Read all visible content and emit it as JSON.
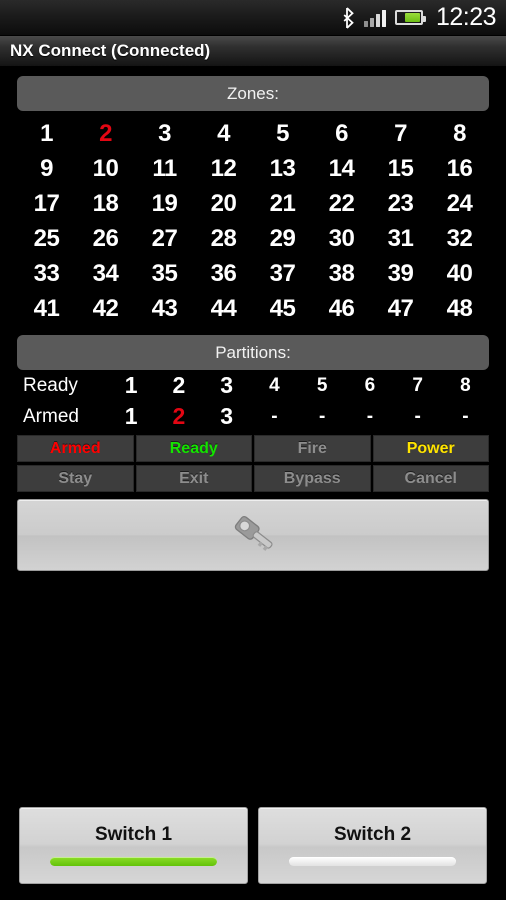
{
  "status_bar": {
    "bluetooth_icon": "bluetooth-icon",
    "signal_icon": "signal-bars-icon",
    "battery_icon": "battery-icon",
    "clock": "12:23"
  },
  "title_bar": {
    "title": "NX Connect (Connected)"
  },
  "zones": {
    "header": "Zones:",
    "items": [
      {
        "label": "1",
        "state": "normal"
      },
      {
        "label": "2",
        "state": "alert"
      },
      {
        "label": "3",
        "state": "normal"
      },
      {
        "label": "4",
        "state": "normal"
      },
      {
        "label": "5",
        "state": "normal"
      },
      {
        "label": "6",
        "state": "normal"
      },
      {
        "label": "7",
        "state": "normal"
      },
      {
        "label": "8",
        "state": "normal"
      },
      {
        "label": "9",
        "state": "normal"
      },
      {
        "label": "10",
        "state": "normal"
      },
      {
        "label": "11",
        "state": "normal"
      },
      {
        "label": "12",
        "state": "normal"
      },
      {
        "label": "13",
        "state": "normal"
      },
      {
        "label": "14",
        "state": "normal"
      },
      {
        "label": "15",
        "state": "normal"
      },
      {
        "label": "16",
        "state": "normal"
      },
      {
        "label": "17",
        "state": "normal"
      },
      {
        "label": "18",
        "state": "normal"
      },
      {
        "label": "19",
        "state": "normal"
      },
      {
        "label": "20",
        "state": "normal"
      },
      {
        "label": "21",
        "state": "normal"
      },
      {
        "label": "22",
        "state": "normal"
      },
      {
        "label": "23",
        "state": "normal"
      },
      {
        "label": "24",
        "state": "normal"
      },
      {
        "label": "25",
        "state": "normal"
      },
      {
        "label": "26",
        "state": "normal"
      },
      {
        "label": "27",
        "state": "normal"
      },
      {
        "label": "28",
        "state": "normal"
      },
      {
        "label": "29",
        "state": "normal"
      },
      {
        "label": "30",
        "state": "normal"
      },
      {
        "label": "31",
        "state": "normal"
      },
      {
        "label": "32",
        "state": "normal"
      },
      {
        "label": "33",
        "state": "normal"
      },
      {
        "label": "34",
        "state": "normal"
      },
      {
        "label": "35",
        "state": "normal"
      },
      {
        "label": "36",
        "state": "normal"
      },
      {
        "label": "37",
        "state": "normal"
      },
      {
        "label": "38",
        "state": "normal"
      },
      {
        "label": "39",
        "state": "normal"
      },
      {
        "label": "40",
        "state": "normal"
      },
      {
        "label": "41",
        "state": "normal"
      },
      {
        "label": "42",
        "state": "normal"
      },
      {
        "label": "43",
        "state": "normal"
      },
      {
        "label": "44",
        "state": "normal"
      },
      {
        "label": "45",
        "state": "normal"
      },
      {
        "label": "46",
        "state": "normal"
      },
      {
        "label": "47",
        "state": "normal"
      },
      {
        "label": "48",
        "state": "normal"
      }
    ]
  },
  "partitions": {
    "header": "Partitions:",
    "ready": {
      "label": "Ready",
      "values": [
        {
          "label": "1",
          "state": "active"
        },
        {
          "label": "2",
          "state": "active"
        },
        {
          "label": "3",
          "state": "active"
        },
        {
          "label": "4",
          "state": "inactive"
        },
        {
          "label": "5",
          "state": "inactive"
        },
        {
          "label": "6",
          "state": "inactive"
        },
        {
          "label": "7",
          "state": "inactive"
        },
        {
          "label": "8",
          "state": "inactive"
        }
      ]
    },
    "armed": {
      "label": "Armed",
      "values": [
        {
          "label": "1",
          "state": "active"
        },
        {
          "label": "2",
          "state": "alert"
        },
        {
          "label": "3",
          "state": "active"
        },
        {
          "label": "-",
          "state": "dash"
        },
        {
          "label": "-",
          "state": "dash"
        },
        {
          "label": "-",
          "state": "dash"
        },
        {
          "label": "-",
          "state": "dash"
        },
        {
          "label": "-",
          "state": "dash"
        }
      ]
    }
  },
  "status_buttons": {
    "row1": [
      {
        "label": "Armed",
        "state": "red"
      },
      {
        "label": "Ready",
        "state": "green"
      },
      {
        "label": "Fire",
        "state": "off"
      },
      {
        "label": "Power",
        "state": "yellow"
      }
    ],
    "row2": [
      {
        "label": "Stay",
        "state": "off"
      },
      {
        "label": "Exit",
        "state": "off"
      },
      {
        "label": "Bypass",
        "state": "off"
      },
      {
        "label": "Cancel",
        "state": "off"
      }
    ]
  },
  "key_button": {
    "icon": "key-icon"
  },
  "switches": [
    {
      "label": "Switch 1",
      "state": "on"
    },
    {
      "label": "Switch 2",
      "state": "off"
    }
  ],
  "colors": {
    "alert_red": "#e30613",
    "status_red": "#ff0000",
    "status_green": "#14e400",
    "status_yellow": "#ffe400",
    "status_off": "#8d8d8d",
    "switch_on": "#7ad017",
    "background": "#000000",
    "header_bar": "#5a5a5a"
  }
}
